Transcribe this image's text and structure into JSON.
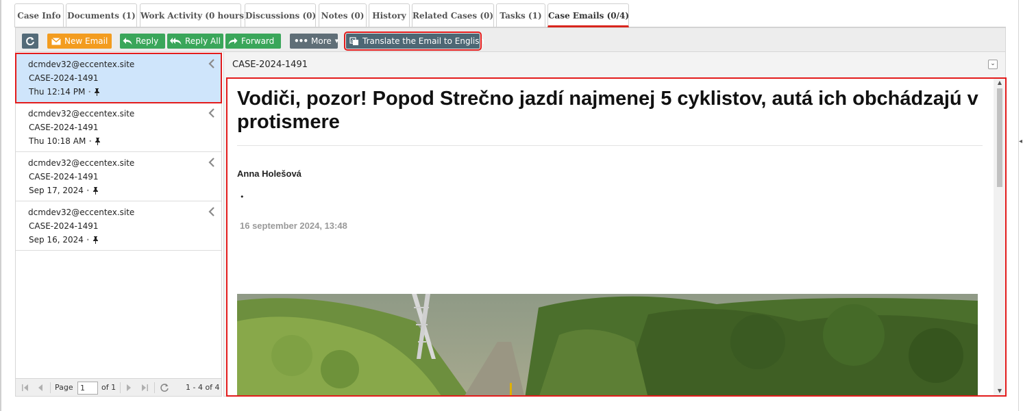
{
  "tabs": [
    {
      "label": "Case Info"
    },
    {
      "label": "Documents (1)"
    },
    {
      "label": "Work Activity (0 hours)"
    },
    {
      "label": "Discussions (0)"
    },
    {
      "label": "Notes (0)"
    },
    {
      "label": "History"
    },
    {
      "label": "Related Cases (0)"
    },
    {
      "label": "Tasks (1)"
    },
    {
      "label": "Case Emails (0/4)"
    }
  ],
  "toolbar": {
    "new_email": "New Email",
    "reply": "Reply",
    "reply_all": "Reply All",
    "forward": "Forward",
    "more": "More",
    "translate": "Translate the Email to English"
  },
  "emails": [
    {
      "from": "dcmdev32@eccentex.site",
      "case": "CASE-2024-1491",
      "date": "Thu 12:14 PM"
    },
    {
      "from": "dcmdev32@eccentex.site",
      "case": "CASE-2024-1491",
      "date": "Thu 10:18 AM"
    },
    {
      "from": "dcmdev32@eccentex.site",
      "case": "CASE-2024-1491",
      "date": "Sep 17, 2024"
    },
    {
      "from": "dcmdev32@eccentex.site",
      "case": "CASE-2024-1491",
      "date": "Sep 16, 2024"
    }
  ],
  "pager": {
    "page_label": "Page",
    "page_value": "1",
    "of_label": "of 1",
    "range": "1 - 4 of 4"
  },
  "reading": {
    "subject": "CASE-2024-1491",
    "headline": "Vodiči, pozor! Popod Strečno jazdí najmenej 5 cyklistov, autá ich obchádzajú v protismere",
    "author": "Anna Holešová",
    "bullet": "•",
    "dateline": "16 september 2024, 13:48"
  },
  "colors": {
    "accent_red": "#e31b1b",
    "new_email_orange": "#f39c1f",
    "reply_green": "#3aa65a",
    "selected_blue": "#cfe5fb"
  }
}
